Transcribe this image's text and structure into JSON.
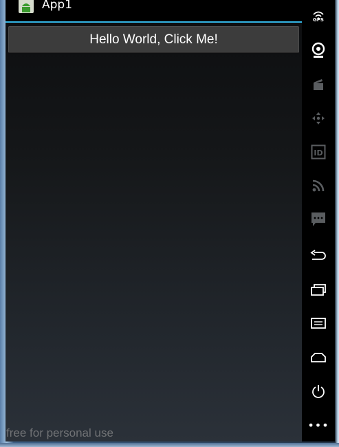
{
  "app": {
    "title": "App1"
  },
  "main": {
    "button_label": "Hello World, Click Me!"
  },
  "watermark": "free for personal use",
  "toolbar": {
    "gps_label": "GPS",
    "id_label": "ID",
    "more_label": "•••",
    "items": [
      {
        "icon": "gps-icon",
        "state": "active"
      },
      {
        "icon": "webcam-icon",
        "state": "active"
      },
      {
        "icon": "clapper-icon",
        "state": "disabled"
      },
      {
        "icon": "dpad-icon",
        "state": "disabled"
      },
      {
        "icon": "id-icon",
        "state": "disabled"
      },
      {
        "icon": "rss-icon",
        "state": "disabled"
      },
      {
        "icon": "sms-icon",
        "state": "disabled"
      },
      {
        "icon": "back-icon",
        "state": "active"
      },
      {
        "icon": "recent-apps-icon",
        "state": "active"
      },
      {
        "icon": "menu-icon",
        "state": "active"
      },
      {
        "icon": "home-icon",
        "state": "active"
      },
      {
        "icon": "power-icon",
        "state": "active"
      },
      {
        "icon": "more-icon",
        "state": "active"
      }
    ]
  },
  "colors": {
    "accent": "#33b5e5",
    "button_bg": "#3c3c3c",
    "toolbar_bg": "#000000",
    "icon_active": "#ffffff",
    "icon_disabled": "#5a5d60"
  }
}
